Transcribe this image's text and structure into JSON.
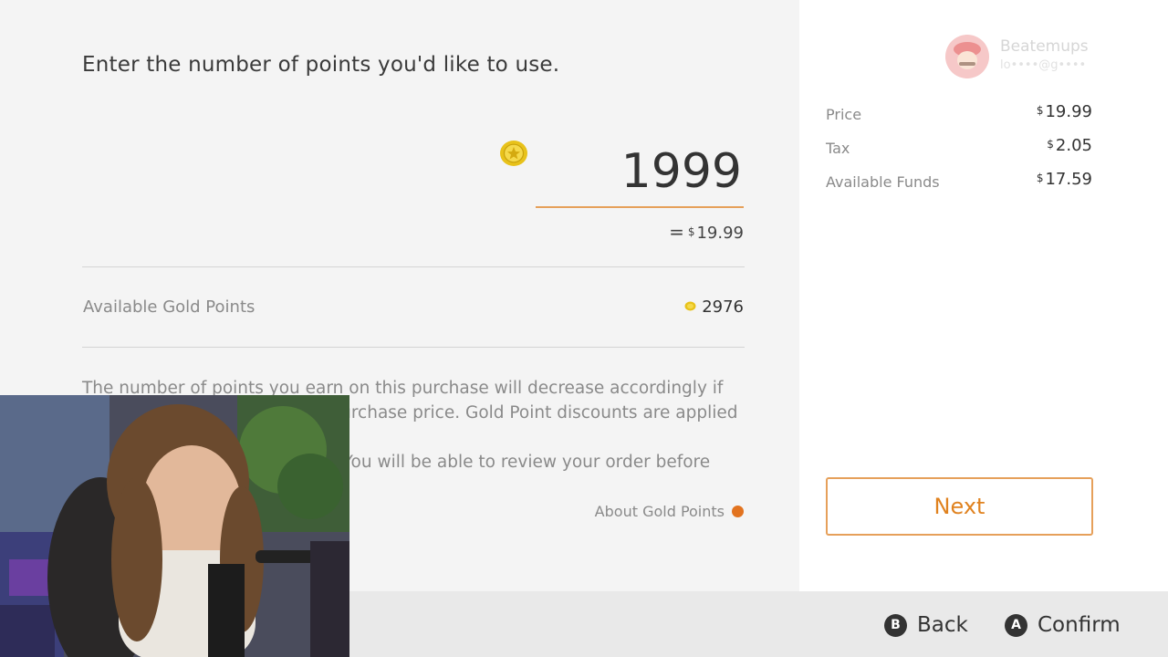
{
  "prompt": "Enter the number of points you'd like to use.",
  "points_input": {
    "value": "1999",
    "equivalent_symbol": "=",
    "equivalent_currency": "$",
    "equivalent_amount": "19.99"
  },
  "available_points": {
    "label": "Available Gold Points",
    "value": "2976"
  },
  "info_text": {
    "line1": "The number of points you earn on this purchase will decrease accordingly if",
    "line2": "you use points to reduce the purchase price. Gold Point discounts are applied to",
    "line3": "the purchase price before tax. You will be able to review your order before"
  },
  "about_link": "About Gold Points",
  "user": {
    "name": "Beatemups",
    "email": "lo••••@g••••"
  },
  "summary": [
    {
      "label": "Price",
      "currency": "$",
      "value": "19.99"
    },
    {
      "label": "Tax",
      "currency": "$",
      "value": "2.05"
    },
    {
      "label": "Available Funds",
      "currency": "$",
      "value": "17.59"
    }
  ],
  "next_label": "Next",
  "footer": {
    "back": {
      "glyph": "B",
      "label": "Back"
    },
    "confirm": {
      "glyph": "A",
      "label": "Confirm"
    }
  },
  "colors": {
    "accent": "#e6a05a",
    "accent_text": "#e0821f",
    "gold": "#e8c21a"
  }
}
